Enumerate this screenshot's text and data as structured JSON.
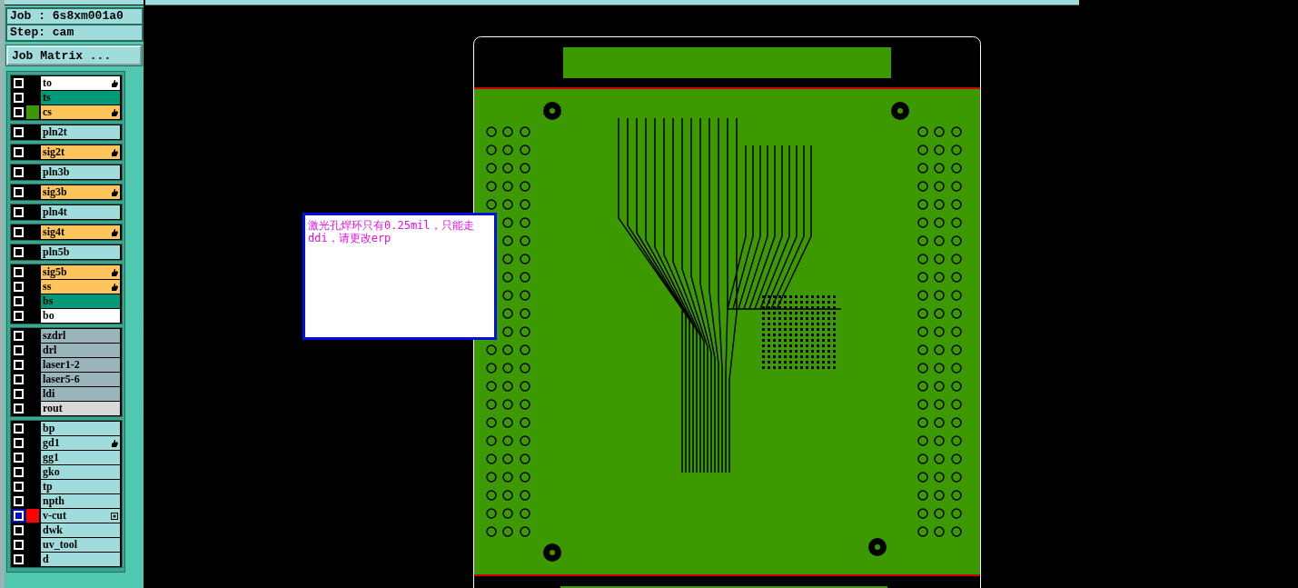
{
  "job": {
    "label": "Job : 6s8xm001a0"
  },
  "step": {
    "label": "Step: cam"
  },
  "job_matrix_button": "Job Matrix ...",
  "layer_groups": [
    {
      "layers": [
        {
          "name": "to",
          "kind": "legend",
          "selected": false,
          "affected": true
        },
        {
          "name": "ts",
          "kind": "mask",
          "selected": false,
          "affected": false
        },
        {
          "name": "cs",
          "kind": "signal",
          "selected": false,
          "affected": true,
          "color": "#3c9a00"
        }
      ]
    },
    {
      "layers": [
        {
          "name": "pln2t",
          "kind": "plane",
          "selected": false,
          "affected": false
        }
      ]
    },
    {
      "layers": [
        {
          "name": "sig2t",
          "kind": "signal",
          "selected": false,
          "affected": true
        }
      ]
    },
    {
      "layers": [
        {
          "name": "pln3b",
          "kind": "plane",
          "selected": false,
          "affected": false
        }
      ]
    },
    {
      "layers": [
        {
          "name": "sig3b",
          "kind": "signal",
          "selected": false,
          "affected": true
        }
      ]
    },
    {
      "layers": [
        {
          "name": "pln4t",
          "kind": "plane",
          "selected": false,
          "affected": false
        }
      ]
    },
    {
      "layers": [
        {
          "name": "sig4t",
          "kind": "signal",
          "selected": false,
          "affected": true
        }
      ]
    },
    {
      "layers": [
        {
          "name": "pln5b",
          "kind": "plane",
          "selected": false,
          "affected": false
        }
      ]
    },
    {
      "layers": [
        {
          "name": "sig5b",
          "kind": "signal",
          "selected": false,
          "affected": true
        },
        {
          "name": "ss",
          "kind": "signal",
          "selected": false,
          "affected": true
        },
        {
          "name": "bs",
          "kind": "mask",
          "selected": false,
          "affected": false
        },
        {
          "name": "bo",
          "kind": "legend",
          "selected": false,
          "affected": false
        }
      ]
    },
    {
      "layers": [
        {
          "name": "szdrl",
          "kind": "drill",
          "selected": false,
          "affected": false
        },
        {
          "name": "drl",
          "kind": "drill",
          "selected": false,
          "affected": false
        },
        {
          "name": "laser1-2",
          "kind": "drill",
          "selected": false,
          "affected": false
        },
        {
          "name": "laser5-6",
          "kind": "drill",
          "selected": false,
          "affected": false
        },
        {
          "name": "ldi",
          "kind": "drill",
          "selected": false,
          "affected": false
        },
        {
          "name": "rout",
          "kind": "rout",
          "selected": false,
          "affected": false
        }
      ]
    },
    {
      "layers": [
        {
          "name": "bp",
          "kind": "document",
          "selected": false,
          "affected": false
        },
        {
          "name": "gd1",
          "kind": "document",
          "selected": false,
          "affected": true
        },
        {
          "name": "gg1",
          "kind": "document",
          "selected": false,
          "affected": false
        },
        {
          "name": "gko",
          "kind": "document",
          "selected": false,
          "affected": false
        },
        {
          "name": "tp",
          "kind": "document",
          "selected": false,
          "affected": false
        },
        {
          "name": "npth",
          "kind": "document",
          "selected": false,
          "affected": false
        },
        {
          "name": "v-cut",
          "kind": "document",
          "selected": true,
          "affected": false,
          "color": "#ff0000",
          "expandable": true
        },
        {
          "name": "dwk",
          "kind": "document",
          "selected": false,
          "affected": false
        },
        {
          "name": "uv_tool",
          "kind": "document",
          "selected": false,
          "affected": false
        },
        {
          "name": "d",
          "kind": "document",
          "selected": false,
          "affected": false
        }
      ]
    }
  ],
  "note": {
    "text": "激光孔焊环只有0.25mil，只能走ddi，请更改erp"
  }
}
